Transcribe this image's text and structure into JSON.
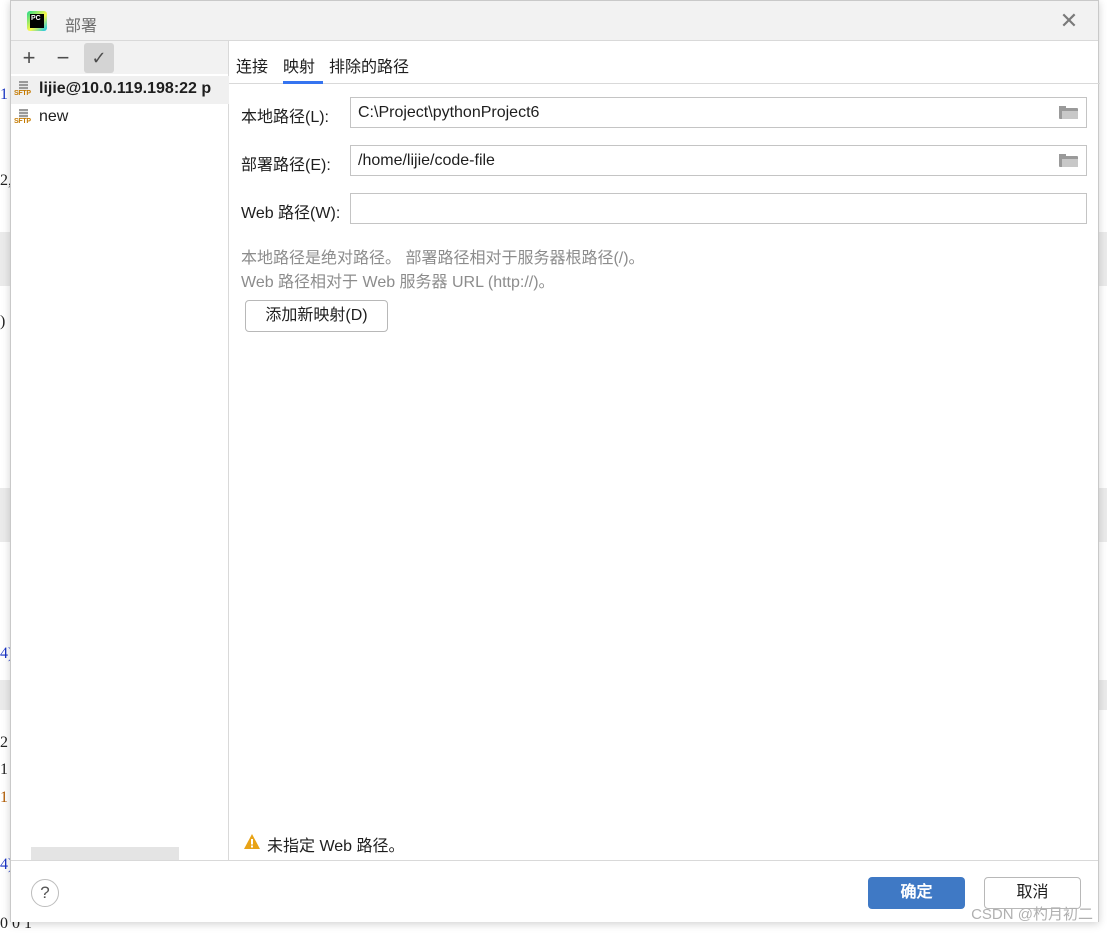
{
  "dialog": {
    "title": "部署",
    "close_icon": "close-icon",
    "app_icon": "pycharm-icon",
    "app_icon_text": "PC"
  },
  "left_toolbar": {
    "add_label": "+",
    "remove_label": "−",
    "default_label": "✓"
  },
  "servers": [
    {
      "name": "lijie@10.0.119.198:22 p",
      "type_label": "SFTP",
      "selected": true
    },
    {
      "name": "new",
      "type_label": "SFTP",
      "selected": false
    }
  ],
  "tabs": [
    {
      "label": "连接"
    },
    {
      "label": "映射"
    },
    {
      "label": "排除的路径"
    }
  ],
  "active_tab": "映射",
  "mapping": {
    "local_path_label": "本地路径(L):",
    "local_path_value": "C:\\Project\\pythonProject6",
    "deploy_path_label": "部署路径(E):",
    "deploy_path_value": "/home/lijie/code-file",
    "web_path_label": "Web 路径(W):",
    "web_path_value": "",
    "hint_line1": "本地路径是绝对路径。 部署路径相对于服务器根路径(/)。",
    "hint_line2": "Web 路径相对于 Web 服务器 URL (http://)。",
    "add_mapping_label": "添加新映射(D)"
  },
  "warning": {
    "icon": "warning-icon",
    "text": "未指定 Web 路径。"
  },
  "footer": {
    "help_label": "?",
    "ok_label": "确定",
    "cancel_label": "取消"
  },
  "background_fragments": [
    "1",
    "2,",
    ")",
    "4)",
    "2",
    "1",
    "1",
    "4)",
    "0  0 1"
  ],
  "watermark": "CSDN @杓月初二",
  "colors": {
    "accent": "#3574f0",
    "ok_button": "#3f79c5",
    "warning": "#e8a317",
    "sftp_label": "#c47a00"
  }
}
